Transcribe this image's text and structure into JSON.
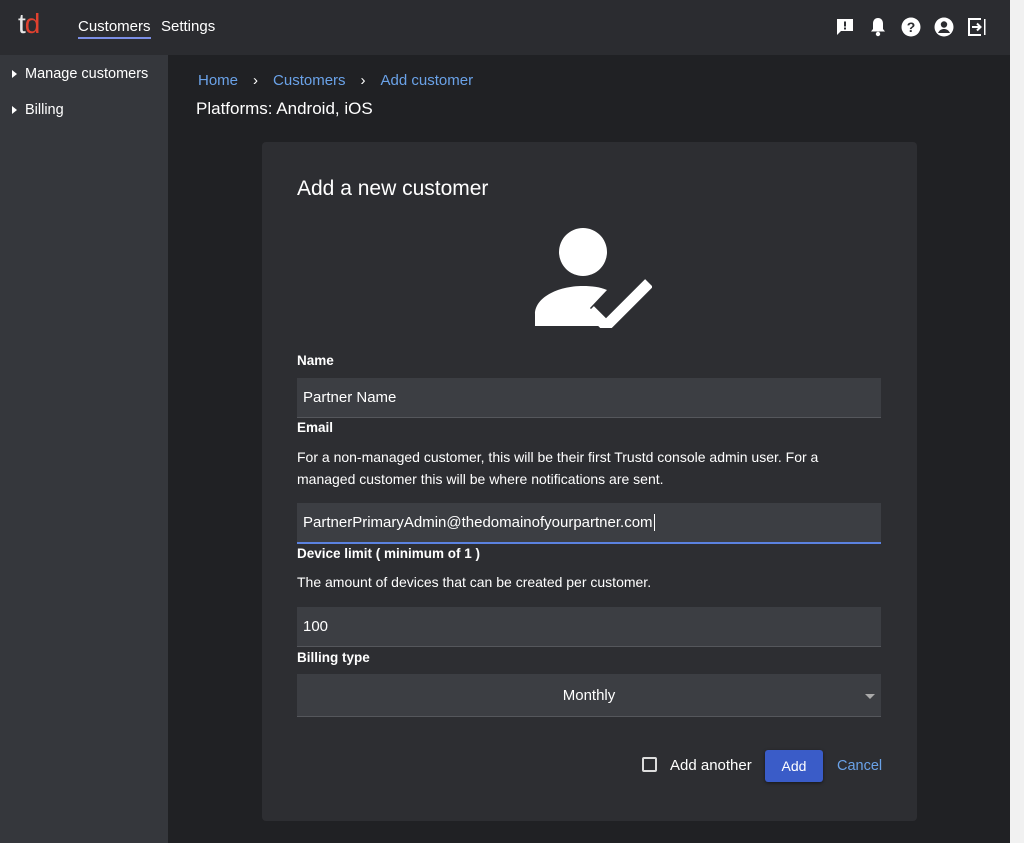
{
  "header": {
    "logo_t": "t",
    "logo_d": "d",
    "nav": [
      {
        "label": "Customers",
        "active": true
      },
      {
        "label": "Settings",
        "active": false
      }
    ],
    "icons": [
      "feedback-icon",
      "bell-icon",
      "help-icon",
      "account-icon",
      "logout-icon"
    ]
  },
  "sidebar": {
    "items": [
      {
        "label": "Manage customers"
      },
      {
        "label": "Billing"
      }
    ]
  },
  "breadcrumb": {
    "items": [
      "Home",
      "Customers",
      "Add customer"
    ],
    "separator": "›"
  },
  "platforms": "Platforms: Android, iOS",
  "form": {
    "title": "Add a new customer",
    "name_label": "Name",
    "name_value": "Partner Name",
    "email_label": "Email",
    "email_help": "For a non-managed customer, this will be their first Trustd console admin user. For a managed customer this will be where notifications are sent.",
    "email_value": "PartnerPrimaryAdmin@thedomainofyourpartner.com",
    "device_label": "Device limit ( minimum of 1 )",
    "device_help": "The amount of devices that can be created per customer.",
    "device_value": "100",
    "billing_label": "Billing type",
    "billing_value": "Monthly",
    "add_another_label": "Add another",
    "add_another_checked": false,
    "add_button": "Add",
    "cancel_button": "Cancel"
  },
  "colors": {
    "accent": "#3a5cc8",
    "link": "#6aa2e8",
    "logo_d": "#e0412f"
  }
}
